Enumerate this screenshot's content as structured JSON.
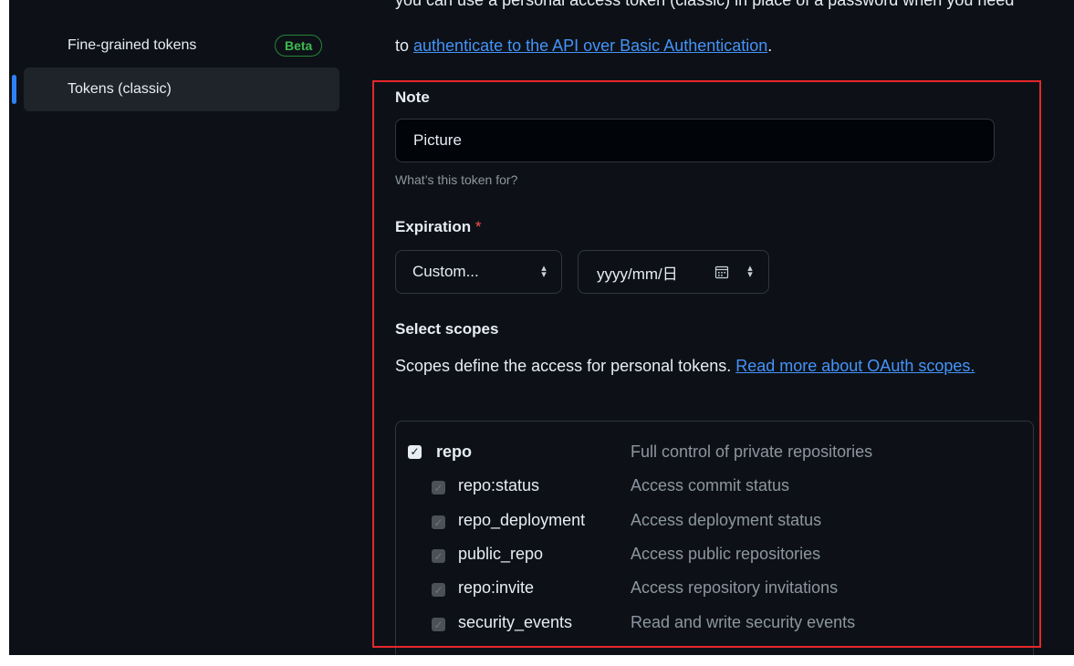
{
  "sidebar": {
    "items": [
      {
        "label": "Fine-grained tokens",
        "badge": "Beta"
      },
      {
        "label": "Tokens (classic)"
      }
    ]
  },
  "intro": {
    "top_line": "you can use a personal access token (classic) in place of a password when you need",
    "prefix": "to ",
    "link": "authenticate to the API over Basic Authentication",
    "suffix": "."
  },
  "note": {
    "label": "Note",
    "value": "Picture",
    "hint": "What’s this token for?"
  },
  "expiration": {
    "label": "Expiration",
    "required_mark": "*",
    "select_value": "Custom...",
    "date_value": "yyyy/mm/日"
  },
  "scopes": {
    "heading": "Select scopes",
    "description": "Scopes define the access for personal tokens. ",
    "link": "Read more about OAuth scopes.",
    "items": [
      {
        "name": "repo",
        "desc": "Full control of private repositories",
        "checked": true,
        "level": 0
      },
      {
        "name": "repo:status",
        "desc": "Access commit status",
        "checked": true,
        "level": 1
      },
      {
        "name": "repo_deployment",
        "desc": "Access deployment status",
        "checked": true,
        "level": 1
      },
      {
        "name": "public_repo",
        "desc": "Access public repositories",
        "checked": true,
        "level": 1
      },
      {
        "name": "repo:invite",
        "desc": "Access repository invitations",
        "checked": true,
        "level": 1
      },
      {
        "name": "security_events",
        "desc": "Read and write security events",
        "checked": true,
        "level": 1
      }
    ]
  },
  "colors": {
    "background": "#0d1117",
    "link": "#4493f8",
    "highlight": "#e5272b",
    "beta": "#3fb950",
    "active_bar": "#2f81f7"
  }
}
